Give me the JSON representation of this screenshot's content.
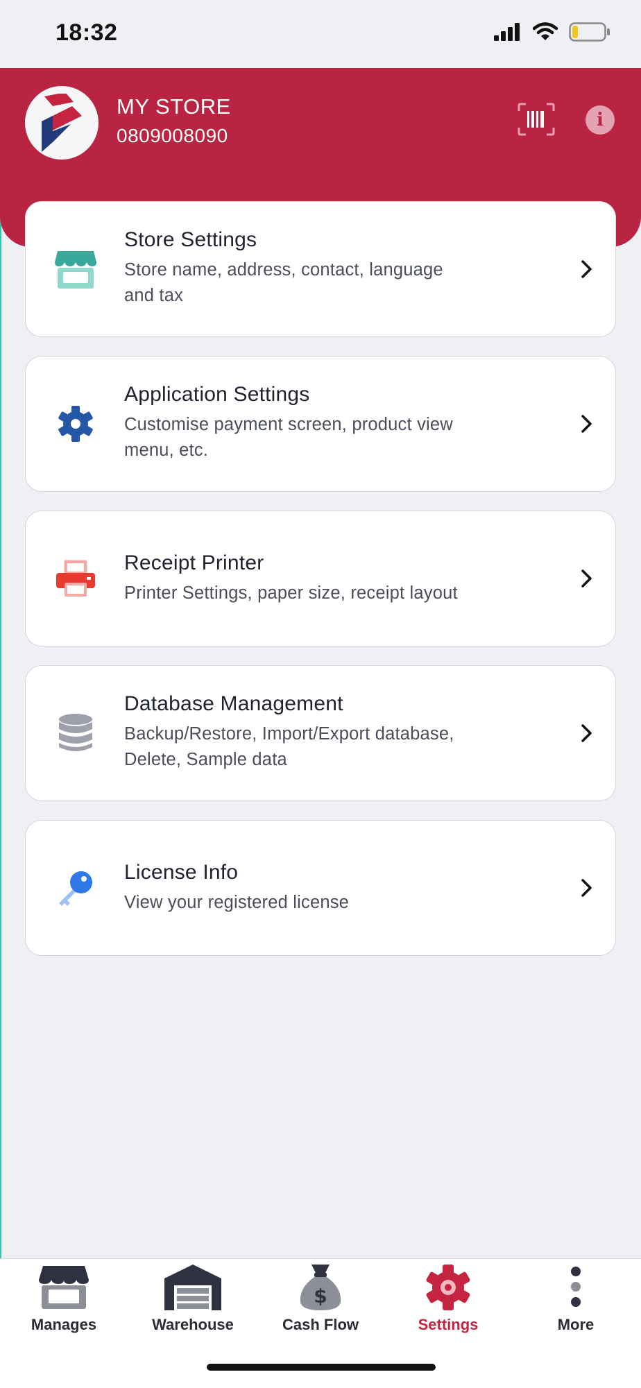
{
  "status_bar": {
    "time": "18:32"
  },
  "header": {
    "store_name": "MY STORE",
    "store_phone": "0809008090",
    "info_glyph": "i",
    "brand_color": "#b82442"
  },
  "settings": [
    {
      "title": "Store Settings",
      "subtitle_line1": "Store name, address, contact, language",
      "subtitle_line2": "and tax",
      "icon": "store-icon"
    },
    {
      "title": "Application Settings",
      "subtitle_line1": "Customise payment screen, product view",
      "subtitle_line2": "menu, etc.",
      "icon": "gear-icon"
    },
    {
      "title": "Receipt Printer",
      "subtitle_line1": "Printer Settings, paper size, receipt layout",
      "subtitle_line2": "",
      "icon": "printer-icon"
    },
    {
      "title": "Database Management",
      "subtitle_line1": "Backup/Restore, Import/Export database,",
      "subtitle_line2": "Delete, Sample data",
      "icon": "database-icon"
    },
    {
      "title": "License Info",
      "subtitle_line1": "View your registered license",
      "subtitle_line2": "",
      "icon": "key-icon"
    }
  ],
  "tab_bar": {
    "tabs": [
      {
        "label": "Manages",
        "icon": "store-icon",
        "active": false
      },
      {
        "label": "Warehouse",
        "icon": "warehouse-icon",
        "active": false
      },
      {
        "label": "Cash Flow",
        "icon": "money-bag-icon",
        "active": false
      },
      {
        "label": "Settings",
        "icon": "gear-icon",
        "active": true
      },
      {
        "label": "More",
        "icon": "more-vertical-icon",
        "active": false
      }
    ],
    "active_color": "#c4243f"
  },
  "colors": {
    "background": "#eff0f4",
    "brand": "#b82442"
  }
}
